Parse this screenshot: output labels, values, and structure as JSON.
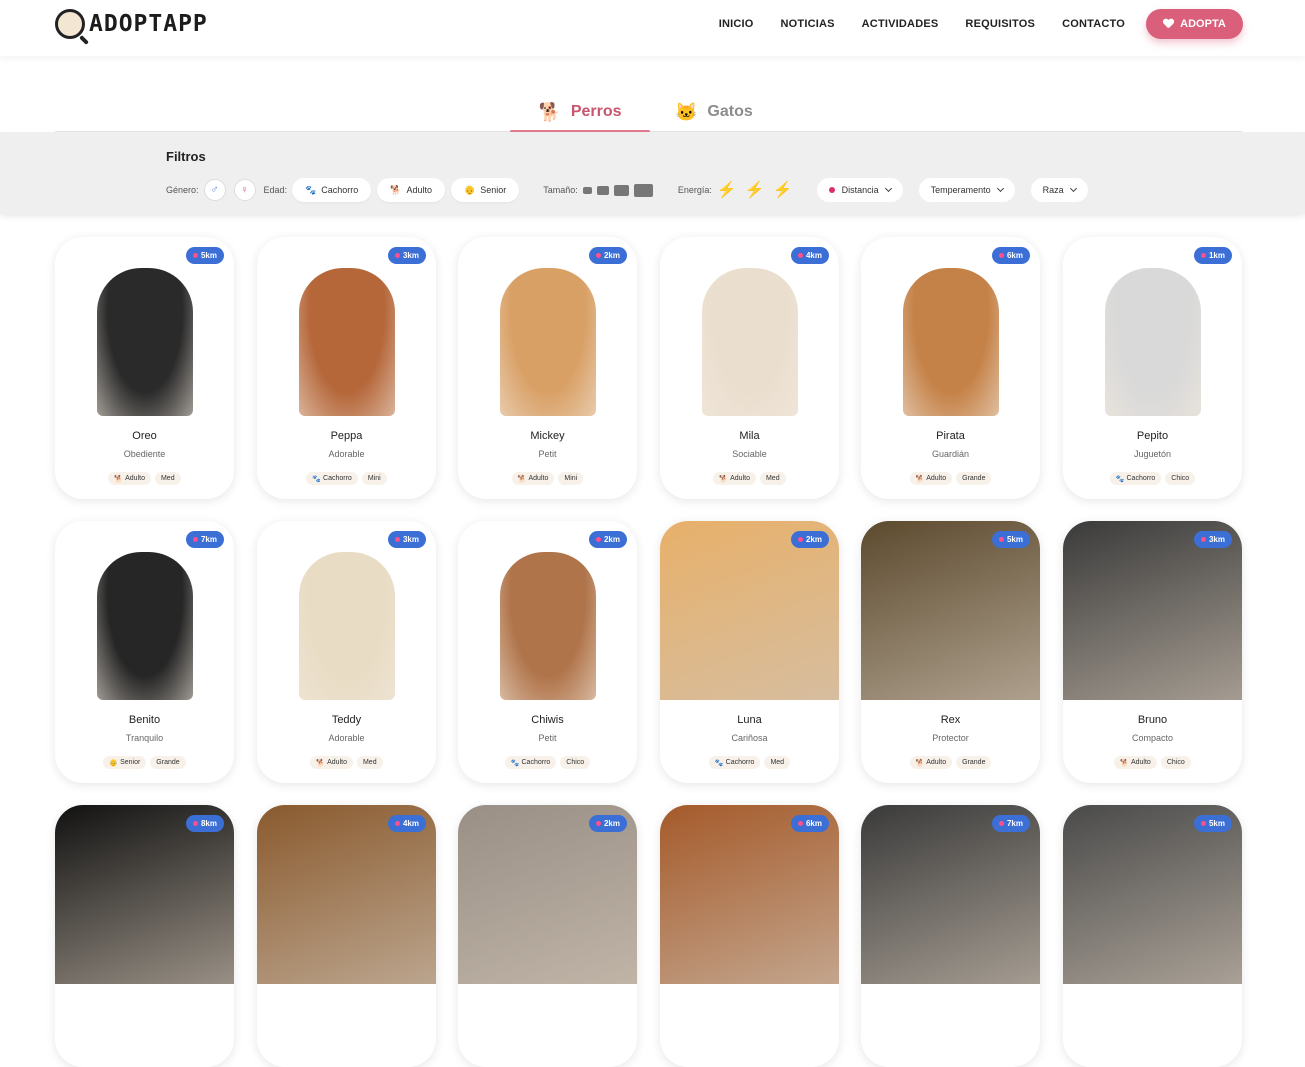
{
  "header": {
    "logo_text": "ADOPTAPP",
    "nav": [
      "INICIO",
      "NOTICIAS",
      "ACTIVIDADES",
      "REQUISITOS",
      "CONTACTO"
    ],
    "cta_label": "ADOPTA",
    "accent_color": "#d95f7a"
  },
  "tabs": {
    "perros": "Perros",
    "gatos": "Gatos",
    "active": "Perros"
  },
  "filters": {
    "title": "Filtros",
    "genero_label": "Género:",
    "edad_label": "Edad:",
    "edad_options": [
      "Cachorro",
      "Adulto",
      "Senior"
    ],
    "tamano_label": "Tamaño:",
    "energia_label": "Energía:",
    "distancia": "Distancia",
    "temperamento": "Temperamento",
    "raza": "Raza"
  },
  "pets": [
    {
      "name": "Oreo",
      "trait": "Obediente",
      "age": "Adulto",
      "size": "Med",
      "distance": "5km",
      "color": "#2a2a2a"
    },
    {
      "name": "Peppa",
      "trait": "Adorable",
      "age": "Cachorro",
      "size": "Mini",
      "distance": "3km",
      "color": "#b5673a"
    },
    {
      "name": "Mickey",
      "trait": "Petit",
      "age": "Adulto",
      "size": "Mini",
      "distance": "2km",
      "color": "#d9a066"
    },
    {
      "name": "Mila",
      "trait": "Sociable",
      "age": "Adulto",
      "size": "Med",
      "distance": "4km",
      "color": "#eadfcf"
    },
    {
      "name": "Pirata",
      "trait": "Guardián",
      "age": "Adulto",
      "size": "Grande",
      "distance": "6km",
      "color": "#c58248"
    },
    {
      "name": "Pepito",
      "trait": "Juguetón",
      "age": "Cachorro",
      "size": "Chico",
      "distance": "1km",
      "color": "#d9d9d9"
    },
    {
      "name": "Benito",
      "trait": "Tranquilo",
      "age": "Senior",
      "size": "Grande",
      "distance": "7km",
      "color": "#262626"
    },
    {
      "name": "Teddy",
      "trait": "Adorable",
      "age": "Adulto",
      "size": "Med",
      "distance": "3km",
      "color": "#e8dcc4"
    },
    {
      "name": "Chiwis",
      "trait": "Petit",
      "age": "Cachorro",
      "size": "Chico",
      "distance": "2km",
      "color": "#b0744a"
    },
    {
      "name": "Luna",
      "trait": "Cariñosa",
      "age": "Cachorro",
      "size": "Med",
      "distance": "2km",
      "color": "#e8b06a"
    },
    {
      "name": "Rex",
      "trait": "Protector",
      "age": "Adulto",
      "size": "Grande",
      "distance": "5km",
      "color": "#5c4a2e"
    },
    {
      "name": "Bruno",
      "trait": "Compacto",
      "age": "Adulto",
      "size": "Chico",
      "distance": "3km",
      "color": "#3a3a3a"
    },
    {
      "name": "",
      "trait": "",
      "age": "",
      "size": "",
      "distance": "8km",
      "color": "#111111"
    },
    {
      "name": "",
      "trait": "",
      "age": "",
      "size": "",
      "distance": "4km",
      "color": "#8a5a2e"
    },
    {
      "name": "",
      "trait": "",
      "age": "",
      "size": "",
      "distance": "2km",
      "color": "#9a8f86"
    },
    {
      "name": "",
      "trait": "",
      "age": "",
      "size": "",
      "distance": "6km",
      "color": "#a55a2a"
    },
    {
      "name": "",
      "trait": "",
      "age": "",
      "size": "",
      "distance": "7km",
      "color": "#3a3a3a"
    },
    {
      "name": "",
      "trait": "",
      "age": "",
      "size": "",
      "distance": "5km",
      "color": "#4a4a4a"
    }
  ]
}
